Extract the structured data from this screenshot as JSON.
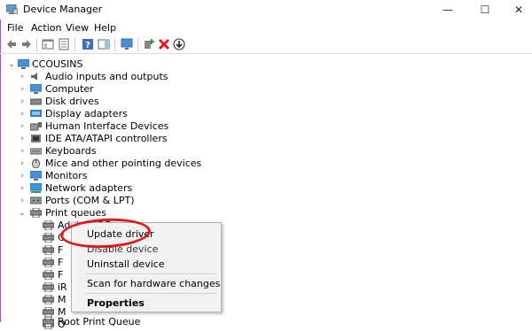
{
  "window": {
    "title": "Device Manager",
    "minimize": "—",
    "maximize": "☐",
    "close": "✕"
  },
  "menu": {
    "file": "File",
    "action": "Action",
    "view": "View",
    "help": "Help"
  },
  "toolbar": {
    "back": "back-icon",
    "forward": "forward-icon"
  },
  "tree": {
    "root": "CCOUSINS",
    "categories": [
      "Audio inputs and outputs",
      "Computer",
      "Disk drives",
      "Display adapters",
      "Human Interface Devices",
      "IDE ATA/ATAPI controllers",
      "Keyboards",
      "Mice and other pointing devices",
      "Monitors",
      "Network adapters",
      "Ports (COM & LPT)",
      "Print queues"
    ],
    "print_children": [
      "Adobe PDF",
      "C",
      "F",
      "F",
      "F",
      "iR",
      "M",
      "M",
      "O",
      "Root Print Queue"
    ]
  },
  "context_menu": {
    "items": [
      "Update driver",
      "Disable device",
      "Uninstall device",
      "Scan for hardware changes",
      "Properties"
    ]
  },
  "colors": {
    "annotation": "#e3161e",
    "accent": "#0078d7"
  }
}
